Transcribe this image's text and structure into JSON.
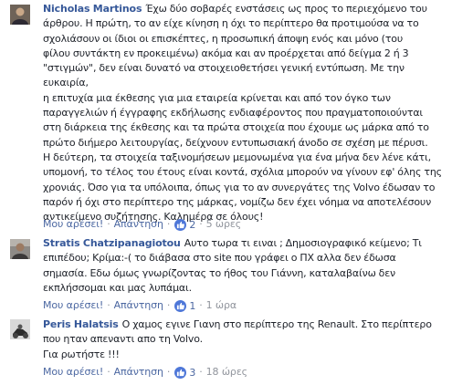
{
  "comments": [
    {
      "author": "Nicholas Martinos",
      "lines": [
        "Έχω δύο σοβαρές ενστάσεις ως προς το περιεχόμενο του",
        "άρθρου. Η πρώτη, το αν είχε κίνηση η όχι το περίπτερο θα προτιμούσα να το",
        "σχολιάσουν οι ίδιοι οι επισκέπτες, η προσωπική άποψη ενός και μόνο (του",
        "φίλου συντάκτη εν προκειμένω) ακόμα και αν προέρχεται από δείγμα 2 ή 3",
        "\"στιγμών\", δεν είναι δυνατό να στοιχειοθετήσει γενική εντύπωση. Με την ευκαιρία,",
        "η επιτυχία μια έκθεσης για μια εταιρεία κρίνεται και από τον όγκο των",
        "παραγγελιών ή έγγραφης εκδήλωσης ενδιαφέροντος που πραγματοποιούνται",
        "στη διάρκεια της έκθεσης και τα πρώτα στοιχεία που έχουμε ως μάρκα από το",
        "πρώτο διήμερο λειτουργίας, δείχνουν εντυπωσιακή άνοδο σε σχέση με πέρυσι.",
        "Η δεύτερη, τα στοιχεία ταξινομήσεων μεμονωμένα για ένα μήνα δεν λένε κάτι,",
        "υπομονή, το τέλος του έτους είναι κοντά, σχόλια μπορούν να γίνουν εφ' όλης της",
        "χρονιάς. Όσο για τα υπόλοιπα, όπως για το αν συνεργάτες της Volvo έδωσαν το",
        "παρόν ή όχι στο περίπτερο της μάρκας, νομίζω δεν έχει νόημα να αποτελέσουν",
        "αντικείμενο συζήτησης. Καλημέρα σε όλους!"
      ],
      "like_label": "Μου αρέσει!",
      "reply_label": "Απάντηση",
      "reaction_count": "2",
      "time": "5 ώρες"
    },
    {
      "author": "Stratis Chatzipanagiotou",
      "lines": [
        "Αυτο τωρα τι ειναι ; Δημοσιογραφικό κείμενο; Τι",
        "επιπέδου; Κρίμα:-( το διάβασα στο site που γράφει ο ΠΧ αλλα δεν έδωσα",
        "σημασία. Εδω όμως γνωρίζοντας το ήθος του Γιάννη, καταλαβαίνω δεν",
        "εκπλήσσομαι και μας λυπάμαι."
      ],
      "like_label": "Μου αρέσει!",
      "reply_label": "Απάντηση",
      "reaction_count": "1",
      "time": "1 ώρα"
    },
    {
      "author": "Peris Halatsis",
      "lines": [
        "Ο χαμος εγινε Γιανη στο περίπτερο της Renault. Στο περίπτερο",
        "που ηταν απεναντι απο τη Volvo.",
        "Για ρωτήστε !!!"
      ],
      "like_label": "Μου αρέσει!",
      "reply_label": "Απάντηση",
      "reaction_count": "3",
      "time": "18 ώρες"
    }
  ],
  "colors": {
    "author": "#365899",
    "link": "#4b67a1",
    "meta": "#90949c",
    "like_badge": "#4e77d8",
    "text": "#1d2129"
  },
  "icons": {
    "reaction": "like-thumb-icon"
  }
}
